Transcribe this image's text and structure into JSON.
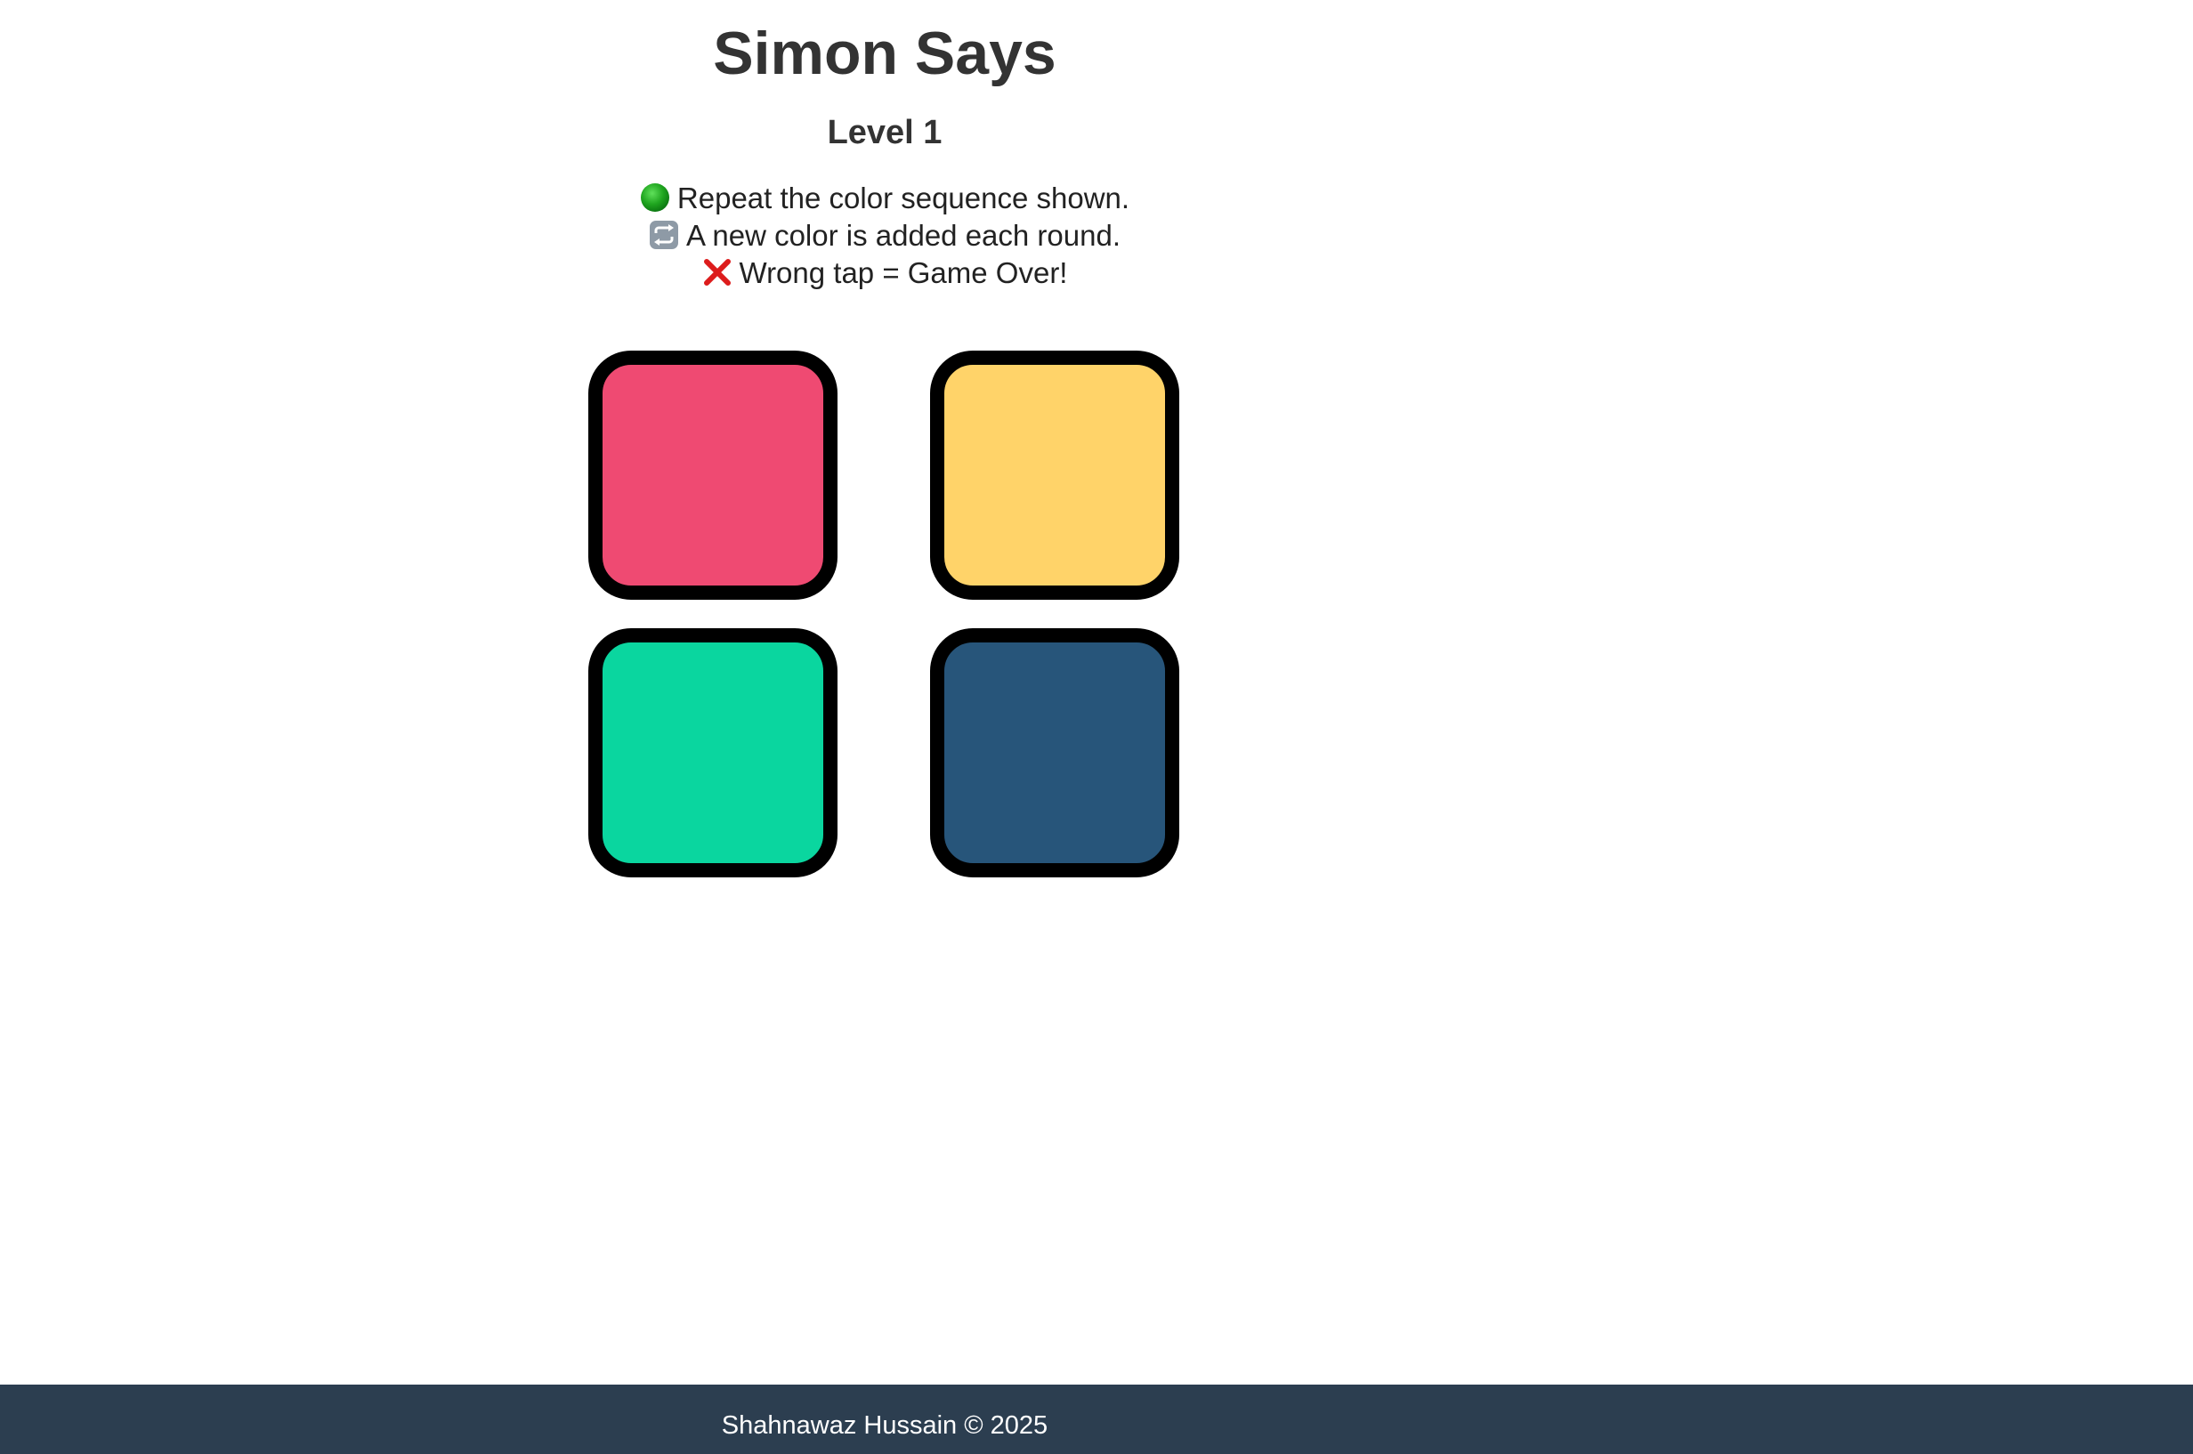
{
  "game": {
    "title": "Simon Says",
    "level": "Level 1"
  },
  "rules": [
    {
      "icon": "green-circle-icon",
      "text": "Repeat the color sequence shown."
    },
    {
      "icon": "repeat-icon",
      "text": "A new color is added each round."
    },
    {
      "icon": "cross-mark-icon",
      "text": "Wrong tap = Game Over!"
    }
  ],
  "pads": {
    "red": {
      "color": "#ef4a72"
    },
    "yellow": {
      "color": "#ffd369"
    },
    "green": {
      "color": "#0ad69f"
    },
    "blue": {
      "color": "#27557a"
    }
  },
  "footer": {
    "text": "Shahnawaz Hussain © 2025",
    "background": "#2c3e50"
  }
}
